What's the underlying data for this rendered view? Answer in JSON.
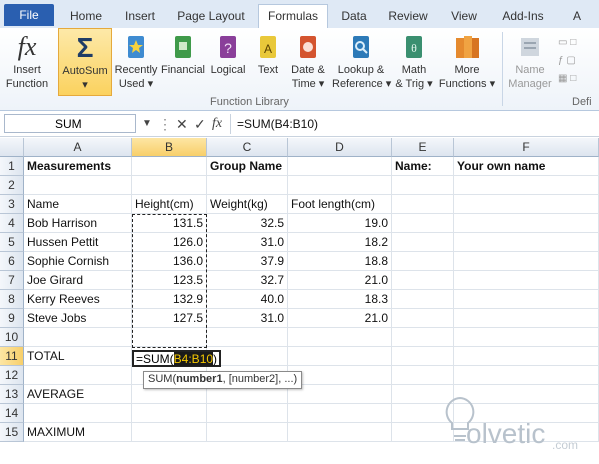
{
  "tabs": [
    "File",
    "Home",
    "Insert",
    "Page Layout",
    "Formulas",
    "Data",
    "Review",
    "View",
    "Add-Ins",
    "A"
  ],
  "ribbon": {
    "insert_function": [
      "Insert",
      "Function"
    ],
    "autosum": "AutoSum",
    "recently_used": [
      "Recently",
      "Used ▾"
    ],
    "financial": "Financial",
    "logical": "Logical",
    "text": "Text",
    "date_time": [
      "Date &",
      "Time ▾"
    ],
    "lookup": [
      "Lookup &",
      "Reference ▾"
    ],
    "math": [
      "Math",
      "& Trig ▾"
    ],
    "more": [
      "More",
      "Functions ▾"
    ],
    "name_manager": [
      "Name",
      "Manager"
    ],
    "group_label": "Function Library",
    "defined_label": "Defi"
  },
  "formula_bar": {
    "name_box": "SUM",
    "cancel": "✕",
    "enter": "✓",
    "fx": "fx",
    "formula": "=SUM(B4:B10)"
  },
  "columns": [
    "A",
    "B",
    "C",
    "D",
    "E",
    "F"
  ],
  "rows": [
    "1",
    "2",
    "3",
    "4",
    "5",
    "6",
    "7",
    "8",
    "9",
    "10",
    "11",
    "12",
    "13",
    "14",
    "15"
  ],
  "cells": {
    "A1": "Measurements",
    "C1": "Group Name",
    "E1": "Name:",
    "F1": "Your own name",
    "A3": "Name",
    "B3": "Height(cm)",
    "C3": "Weight(kg)",
    "D3": "Foot length(cm)",
    "A4": "Bob Harrison",
    "B4": "131.5",
    "C4": "32.5",
    "D4": "19.0",
    "A5": "Hussen Pettit",
    "B5": "126.0",
    "C5": "31.0",
    "D5": "18.2",
    "A6": "Sophie Cornish",
    "B6": "136.0",
    "C6": "37.9",
    "D6": "18.8",
    "A7": "Joe Girard",
    "B7": "123.5",
    "C7": "32.7",
    "D7": "21.0",
    "A8": "Kerry Reeves",
    "B8": "132.9",
    "C8": "40.0",
    "D8": "18.3",
    "A9": "Steve Jobs",
    "B9": "127.5",
    "C9": "31.0",
    "D9": "21.0",
    "A11": "TOTAL",
    "A13": "AVERAGE",
    "A15": "MAXIMUM"
  },
  "edit": {
    "prefix": "=SUM(",
    "ref": "B4:B10",
    "suffix": ")"
  },
  "tooltip": {
    "fn": "SUM(",
    "arg1": "number1",
    "rest": ", [number2], ...)"
  },
  "watermark": {
    "text": "olvetic",
    "com": ".com"
  }
}
